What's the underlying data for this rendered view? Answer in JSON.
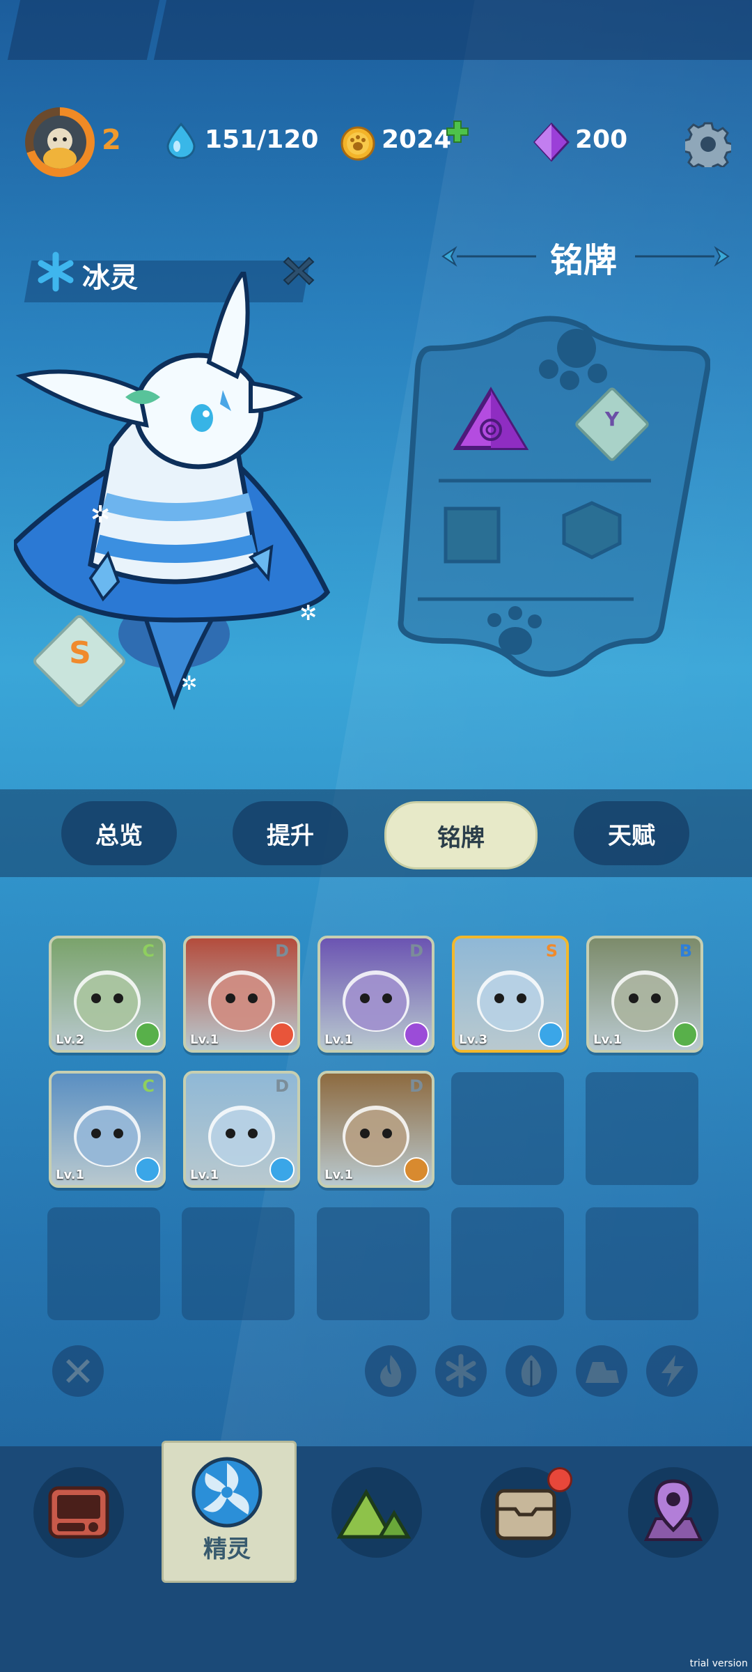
{
  "status_bar": {
    "player_level": "2",
    "water": "151/120",
    "coins": "2024",
    "gems": "200"
  },
  "creature": {
    "name": "冰灵",
    "grade": "S"
  },
  "badge_panel": {
    "title": "铭牌",
    "badge_1_letter": "Y"
  },
  "tabs": [
    "总览",
    "提升",
    "铭牌",
    "天赋"
  ],
  "roster": [
    {
      "level": "Lv.2",
      "grade": "C",
      "element": "leaf",
      "grade_color": "#8fcf5f",
      "bg": "#7aa36b"
    },
    {
      "level": "Lv.1",
      "grade": "D",
      "element": "fire",
      "grade_color": "#7b8d99",
      "bg": "#b44c3c"
    },
    {
      "level": "Lv.1",
      "grade": "D",
      "element": "lightning",
      "grade_color": "#7b8d99",
      "bg": "#6b54b2"
    },
    {
      "level": "Lv.3",
      "grade": "S",
      "element": "ice",
      "grade_color": "#f08a2c",
      "bg": "#8fb8d6"
    },
    {
      "level": "Lv.1",
      "grade": "B",
      "element": "leaf",
      "grade_color": "#2f7fd9",
      "bg": "#7c8b6a"
    },
    {
      "level": "Lv.1",
      "grade": "C",
      "element": "ice",
      "grade_color": "#8fcf5f",
      "bg": "#5a8fc2"
    },
    {
      "level": "Lv.1",
      "grade": "D",
      "element": "ice",
      "grade_color": "#7b8d99",
      "bg": "#8fb8d6"
    },
    {
      "level": "Lv.1",
      "grade": "D",
      "element": "earth",
      "grade_color": "#7b8d99",
      "bg": "#8d6a3f"
    }
  ],
  "bottom_nav": {
    "active_label": "精灵"
  },
  "watermark": "trial version"
}
